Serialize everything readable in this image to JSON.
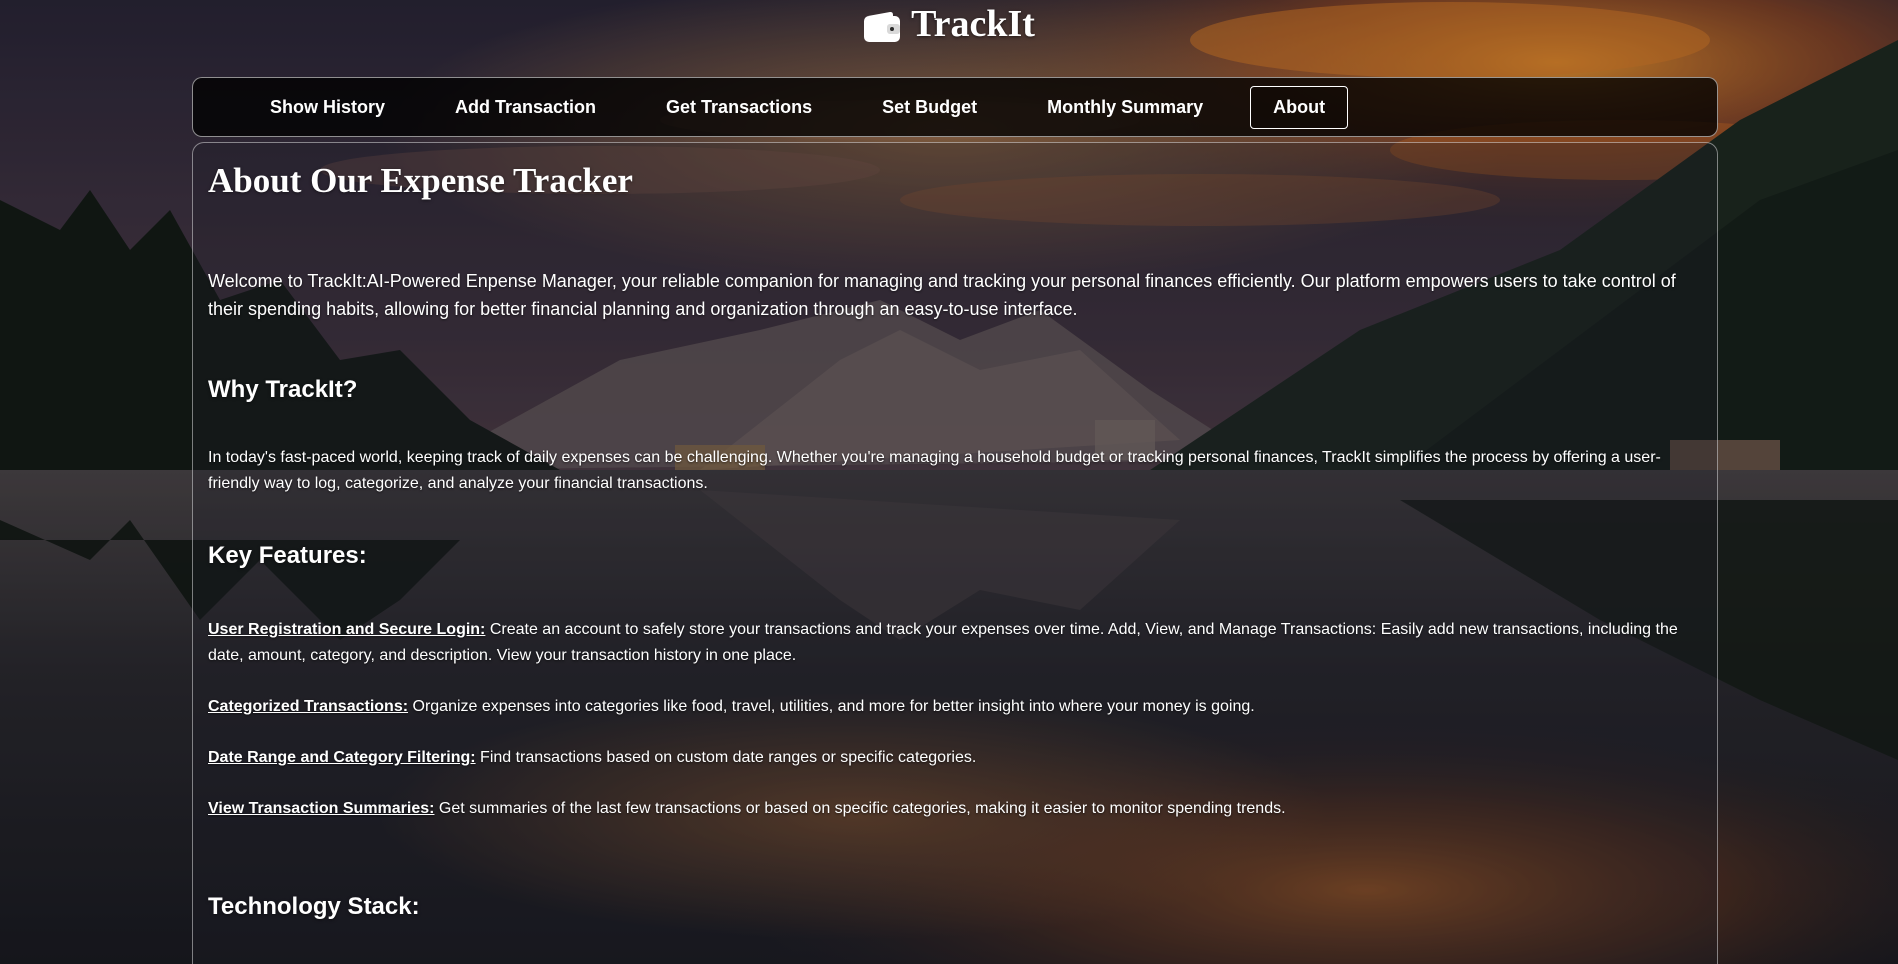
{
  "app": {
    "logo_text": "TrackIt",
    "logo_icon": "wallet-icon"
  },
  "nav": {
    "items": [
      {
        "label": "Show History",
        "active": false
      },
      {
        "label": "Add Transaction",
        "active": false
      },
      {
        "label": "Get Transactions",
        "active": false
      },
      {
        "label": "Set Budget",
        "active": false
      },
      {
        "label": "Monthly Summary",
        "active": false
      },
      {
        "label": "About",
        "active": true
      }
    ]
  },
  "about": {
    "title": "About Our Expense Tracker",
    "intro": "Welcome to TrackIt:AI-Powered Enpense Manager, your reliable companion for managing and tracking your personal finances efficiently. Our platform empowers users to take control of their spending habits, allowing for better financial planning and organization through an easy-to-use interface.",
    "why_heading": "Why TrackIt?",
    "why_text": "In today's fast-paced world, keeping track of daily expenses can be challenging. Whether you're managing a household budget or tracking personal finances, TrackIt simplifies the process by offering a user-friendly way to log, categorize, and analyze your financial transactions.",
    "features_heading": "Key Features:",
    "features": [
      {
        "title": "User Registration and Secure Login:",
        "text": " Create an account to safely store your transactions and track your expenses over time. Add, View, and Manage Transactions: Easily add new transactions, including the date, amount, category, and description. View your transaction history in one place."
      },
      {
        "title": "Categorized Transactions:",
        "text": " Organize expenses into categories like food, travel, utilities, and more for better insight into where your money is going."
      },
      {
        "title": "Date Range and Category Filtering:",
        "text": " Find transactions based on custom date ranges or specific categories."
      },
      {
        "title": "View Transaction Summaries:",
        "text": " Get summaries of the last few transactions or based on specific categories, making it easier to monitor spending trends."
      }
    ],
    "tech_heading": "Technology Stack:"
  },
  "theme": {
    "text_color": "#ffffff",
    "nav_background": "#000000",
    "panel_border": "#ffffff",
    "sky_top": "#2a2638",
    "sunset_glow": "#e07a2a",
    "lake_color": "#1d1f26"
  }
}
